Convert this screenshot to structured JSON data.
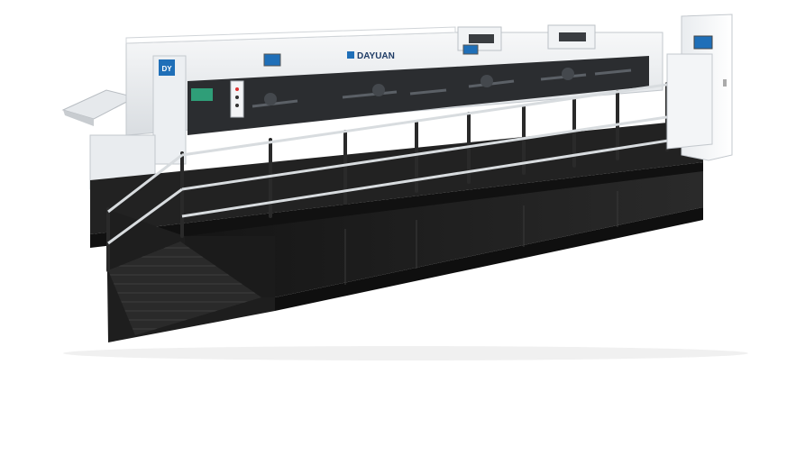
{
  "product": {
    "brand_name": "DAYUAN",
    "logo_text": "DY"
  },
  "colors": {
    "machine_white": "#eef0f2",
    "machine_grey": "#cfd3d7",
    "platform_black": "#1c1c1c",
    "window_dark": "#2b2d30",
    "accent_blue": "#1f6fb8",
    "rail_grey": "#9ea3a8"
  }
}
